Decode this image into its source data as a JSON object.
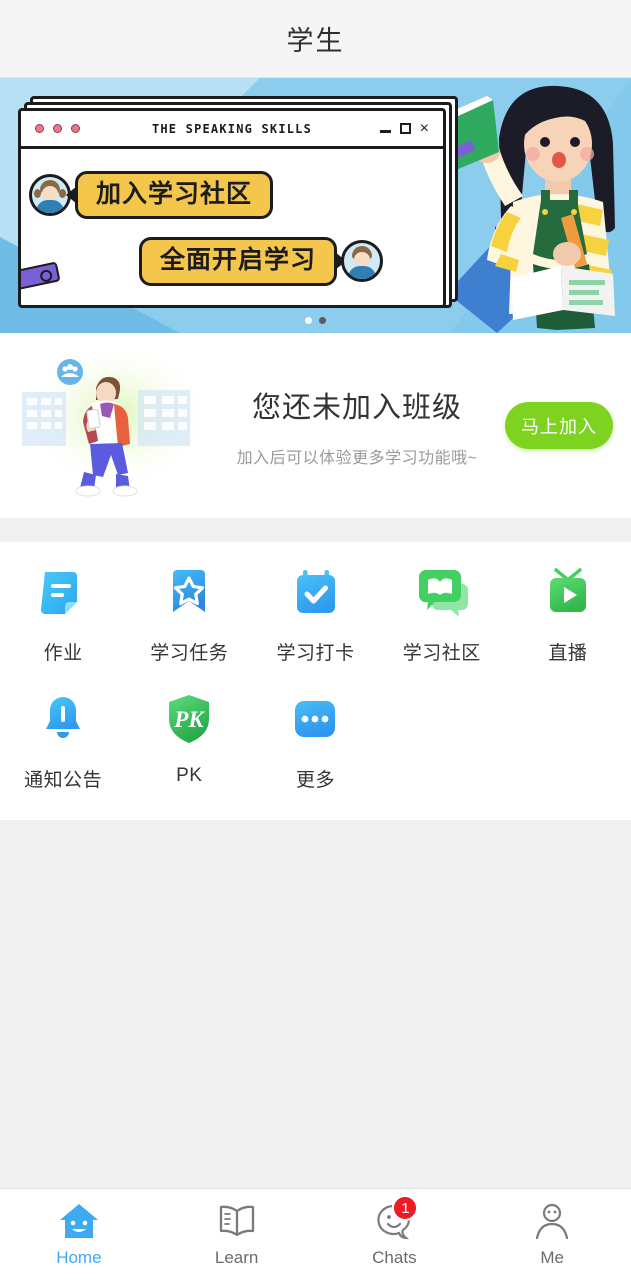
{
  "header": {
    "title": "学生"
  },
  "banner": {
    "window_title": "THE SPEAKING SKILLS",
    "bubble_1": "加入学习社区",
    "bubble_2": "全面开启学习",
    "close_label": "×",
    "dots": [
      "inactive",
      "active"
    ],
    "bg_color": "#8ccdee",
    "bubble_color": "#f4c64c"
  },
  "join_card": {
    "title": "您还未加入班级",
    "subtitle": "加入后可以体验更多学习功能哦~",
    "button_label": "马上加入",
    "button_color": "#7ed321"
  },
  "grid": {
    "row1": [
      {
        "label": "作业",
        "icon": "document-icon",
        "color": "#3bbdf5"
      },
      {
        "label": "学习任务",
        "icon": "bookmark-star-icon",
        "color": "#2f9cf0"
      },
      {
        "label": "学习打卡",
        "icon": "calendar-check-icon",
        "color": "#33a9f0"
      },
      {
        "label": "学习社区",
        "icon": "community-bubble-icon",
        "color": "#4cd964"
      },
      {
        "label": "直播",
        "icon": "live-tv-icon",
        "color": "#4bc85a"
      }
    ],
    "row2": [
      {
        "label": "通知公告",
        "icon": "bell-icon",
        "color": "#32b5f5"
      },
      {
        "label": "PK",
        "icon": "pk-shield-icon",
        "color": "#3dc860"
      },
      {
        "label": "更多",
        "icon": "more-dots-icon",
        "color": "#33a4f0"
      }
    ]
  },
  "tabbar": {
    "items": [
      {
        "label": "Home",
        "icon": "home-icon",
        "active": true,
        "badge": ""
      },
      {
        "label": "Learn",
        "icon": "book-icon",
        "active": false,
        "badge": ""
      },
      {
        "label": "Chats",
        "icon": "chat-smiley-icon",
        "active": false,
        "badge": "1"
      },
      {
        "label": "Me",
        "icon": "person-icon",
        "active": false,
        "badge": ""
      }
    ],
    "active_color": "#3eaaf0"
  }
}
